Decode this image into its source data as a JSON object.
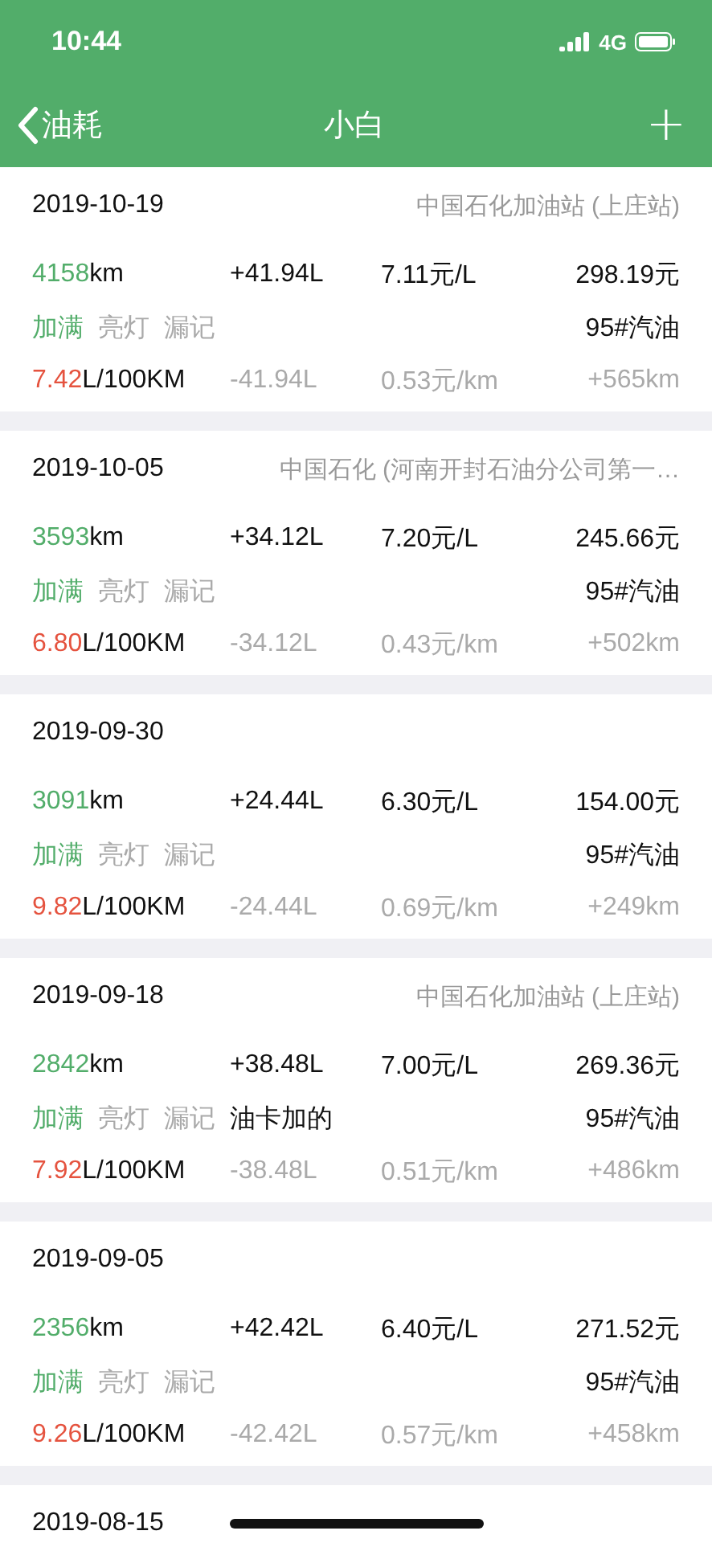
{
  "status_bar": {
    "time": "10:44",
    "network": "4G"
  },
  "nav": {
    "back_label": "油耗",
    "title": "小白",
    "add_label": "+"
  },
  "records": [
    {
      "date": "2019-10-19",
      "station": "中国石化加油站 (上庄站)",
      "odometer": "4158",
      "odometer_unit": "km",
      "volume": "+41.94L",
      "unit_price": "7.11元/L",
      "amount": "298.19元",
      "tags": [
        {
          "label": "加满",
          "on": true
        },
        {
          "label": "亮灯",
          "on": false
        },
        {
          "label": "漏记",
          "on": false
        }
      ],
      "fuel": "95#汽油",
      "consumption": "7.42",
      "consumption_unit": "L/100KM",
      "used": "-41.94L",
      "cost_per_km": "0.53元/km",
      "distance": "+565km"
    },
    {
      "date": "2019-10-05",
      "station": "中国石化 (河南开封石油分公司第一…",
      "odometer": "3593",
      "odometer_unit": "km",
      "volume": "+34.12L",
      "unit_price": "7.20元/L",
      "amount": "245.66元",
      "tags": [
        {
          "label": "加满",
          "on": true
        },
        {
          "label": "亮灯",
          "on": false
        },
        {
          "label": "漏记",
          "on": false
        }
      ],
      "fuel": "95#汽油",
      "consumption": "6.80",
      "consumption_unit": "L/100KM",
      "used": "-34.12L",
      "cost_per_km": "0.43元/km",
      "distance": "+502km"
    },
    {
      "date": "2019-09-30",
      "odometer": "3091",
      "odometer_unit": "km",
      "volume": "+24.44L",
      "unit_price": "6.30元/L",
      "amount": "154.00元",
      "tags": [
        {
          "label": "加满",
          "on": true
        },
        {
          "label": "亮灯",
          "on": false
        },
        {
          "label": "漏记",
          "on": false
        }
      ],
      "fuel": "95#汽油",
      "consumption": "9.82",
      "consumption_unit": "L/100KM",
      "used": "-24.44L",
      "cost_per_km": "0.69元/km",
      "distance": "+249km"
    },
    {
      "date": "2019-09-18",
      "station": "中国石化加油站 (上庄站)",
      "odometer": "2842",
      "odometer_unit": "km",
      "volume": "+38.48L",
      "unit_price": "7.00元/L",
      "amount": "269.36元",
      "tags": [
        {
          "label": "加满",
          "on": true
        },
        {
          "label": "亮灯",
          "on": false
        },
        {
          "label": "漏记",
          "on": false
        }
      ],
      "note": "油卡加的",
      "fuel": "95#汽油",
      "consumption": "7.92",
      "consumption_unit": "L/100KM",
      "used": "-38.48L",
      "cost_per_km": "0.51元/km",
      "distance": "+486km"
    },
    {
      "date": "2019-09-05",
      "odometer": "2356",
      "odometer_unit": "km",
      "volume": "+42.42L",
      "unit_price": "6.40元/L",
      "amount": "271.52元",
      "tags": [
        {
          "label": "加满",
          "on": true
        },
        {
          "label": "亮灯",
          "on": false
        },
        {
          "label": "漏记",
          "on": false
        }
      ],
      "fuel": "95#汽油",
      "consumption": "9.26",
      "consumption_unit": "L/100KM",
      "used": "-42.42L",
      "cost_per_km": "0.57元/km",
      "distance": "+458km"
    },
    {
      "date": "2019-08-15"
    }
  ]
}
